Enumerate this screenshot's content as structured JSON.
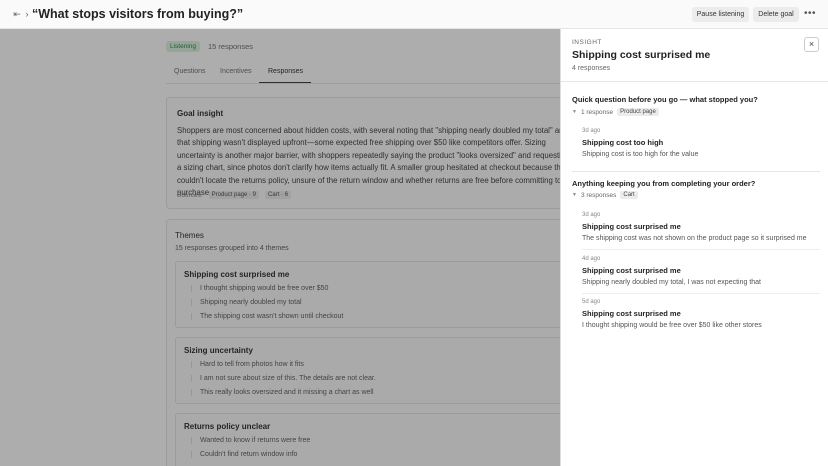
{
  "topbar": {
    "title": "“What stops visitors from buying?”",
    "pause_label": "Pause listening",
    "delete_label": "Delete goal",
    "more_label": "•••"
  },
  "main": {
    "status_badge": "Listening",
    "response_count": "15 responses",
    "tabs": [
      {
        "label": "Questions"
      },
      {
        "label": "Incentives"
      },
      {
        "label": "Responses"
      }
    ],
    "goal_insight": {
      "title": "Goal insight",
      "text": "Shoppers are most concerned about hidden costs, with several noting that \"shipping nearly doubled my total\" and that shipping wasn't displayed upfront—some expected free shipping over $50 like competitors offer. Sizing uncertainty is another major barrier, with shoppers repeatedly saying the product \"looks oversized\" and requesting a sizing chart, since photos don't clarify how items actually fit. A smaller group hesitated at checkout because they couldn't locate the returns policy, unsure of the return window and whether returns are free before committing to a purchase.",
      "sources_label": "Sources:",
      "sources": [
        "Product page · 9",
        "Cart · 6"
      ]
    },
    "themes": {
      "title": "Themes",
      "subtitle": "15 responses grouped into 4 themes",
      "groups": [
        {
          "title": "Shipping cost surprised me",
          "items": [
            "I thought shipping would be free over $50",
            "Shipping nearly doubled my total",
            "The shipping cost wasn't shown until checkout"
          ]
        },
        {
          "title": "Sizing uncertainty",
          "items": [
            "Hard to tell from photos how it fits",
            "I am not sure about size of this. The details are not clear.",
            "This really looks oversized and it missing a chart as well"
          ]
        },
        {
          "title": "Returns policy unclear",
          "items": [
            "Wanted to know if returns were free",
            "Couldn't find return window info"
          ]
        }
      ]
    }
  },
  "panel": {
    "eyebrow": "INSIGHT",
    "title": "Shipping cost surprised me",
    "count": "4 responses",
    "close_icon": "×",
    "questions": [
      {
        "title": "Quick question before you go — what stopped you?",
        "meta": "1 response",
        "tag": "Product page",
        "responses": [
          {
            "time": "3d ago",
            "title": "Shipping cost too high",
            "text": "Shipping cost is too high for the value"
          }
        ]
      },
      {
        "title": "Anything keeping you from completing your order?",
        "meta": "3 responses",
        "tag": "Cart",
        "responses": [
          {
            "time": "3d ago",
            "title": "Shipping cost surprised me",
            "text": "The shipping cost was not shown on the product page so it surprised me"
          },
          {
            "time": "4d ago",
            "title": "Shipping cost surprised me",
            "text": "Shipping nearly doubled my total, I was not expecting that"
          },
          {
            "time": "5d ago",
            "title": "Shipping cost surprised me",
            "text": "I thought shipping would be free over $50 like other stores"
          }
        ]
      }
    ]
  }
}
